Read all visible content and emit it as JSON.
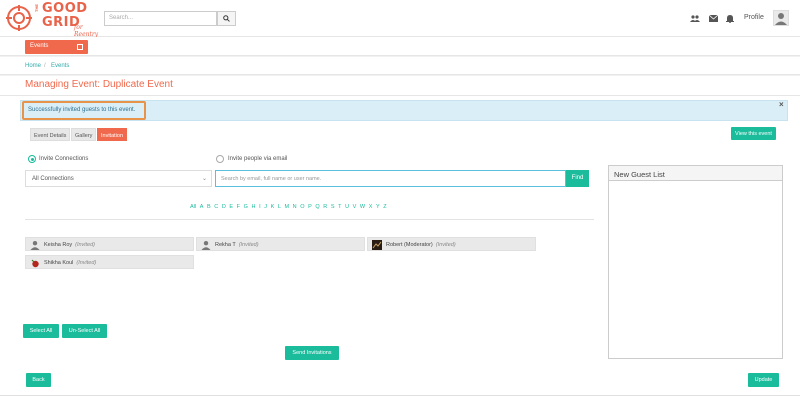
{
  "header": {
    "logo_line1": "GOOD",
    "logo_line2": "GRID",
    "logo_the": "THE",
    "logo_tagline": "for Reentry",
    "search_placeholder": "Search...",
    "profile_label": "Profile"
  },
  "nav": {
    "events_label": "Events"
  },
  "breadcrumb": {
    "home": "Home",
    "separator": "/",
    "events": "Events"
  },
  "page": {
    "title": "Managing Event: Duplicate Event"
  },
  "alert": {
    "message": "Successfully invited guests to this event.",
    "close": "×"
  },
  "tabs": [
    {
      "label": "Event Details",
      "active": false
    },
    {
      "label": "Gallery",
      "active": false
    },
    {
      "label": "Invitation",
      "active": true
    }
  ],
  "view_event_label": "View this event",
  "invite": {
    "option_connections": "Invite Connections",
    "option_email": "Invite people via email",
    "connections_selected": "All Connections",
    "search_placeholder": "Search by email, full name or user name.",
    "find_label": "Find"
  },
  "alphabet": [
    "All",
    "A",
    "B",
    "C",
    "D",
    "E",
    "F",
    "G",
    "H",
    "I",
    "J",
    "K",
    "L",
    "M",
    "N",
    "O",
    "P",
    "Q",
    "R",
    "S",
    "T",
    "U",
    "V",
    "W",
    "X",
    "Y",
    "Z"
  ],
  "guests": [
    {
      "name": "Keisha Roy",
      "status": "(Invited)",
      "icon": "person-icon"
    },
    {
      "name": "Rekha T",
      "status": "(Invited)",
      "icon": "person-icon"
    },
    {
      "name": "Robert (Moderator)",
      "status": "(Invited)",
      "icon": "photo-avatar"
    },
    {
      "name": "Shikha Koul",
      "status": "(Invited)",
      "icon": "photo-avatar-red"
    }
  ],
  "actions": {
    "select_all": "Select All",
    "unselect_all": "Un-Select All",
    "send_invitations": "Send Invitations",
    "back": "Back",
    "update": "Update"
  },
  "new_guest_list": {
    "title": "New Guest List"
  },
  "colors": {
    "brand": "#f0694d",
    "accent": "#1abc9c",
    "alert_bg": "#d9eef7"
  }
}
